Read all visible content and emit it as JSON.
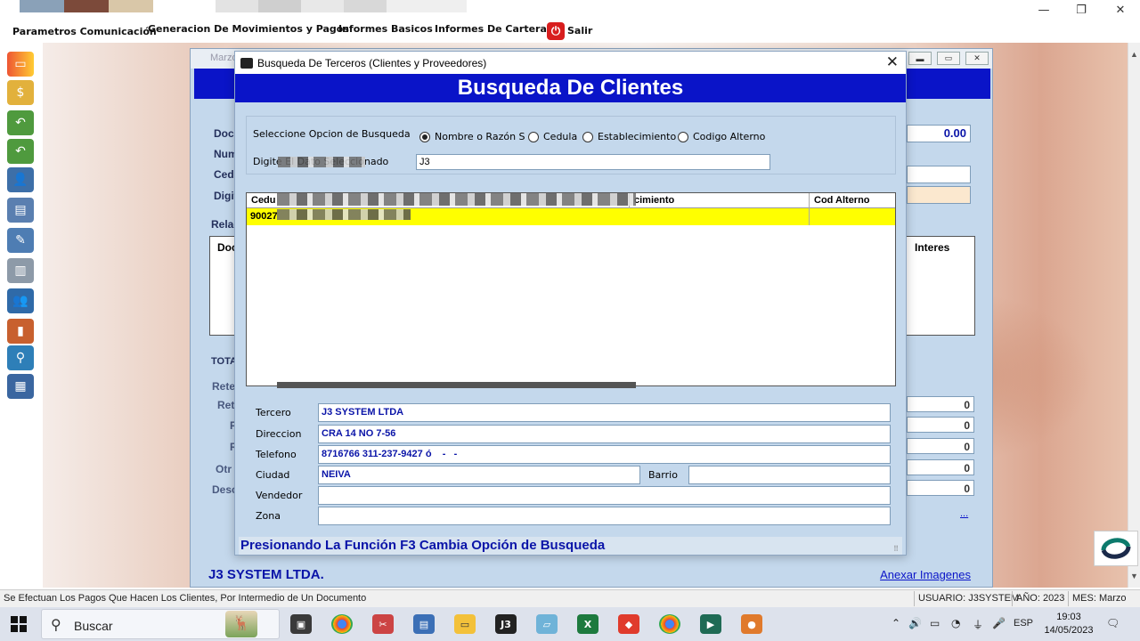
{
  "menu": {
    "items": [
      "Parametros Comunicación",
      "Generacion De Movimientos y Pagos",
      "Informes Basicos",
      "Informes De Cartera"
    ],
    "exit_label": "Salir"
  },
  "window_controls": {
    "minimize": "—",
    "restore": "❐",
    "close": "✕"
  },
  "back_window": {
    "title_fragment": "Marzo",
    "labels": [
      "Doc",
      "Num",
      "Cedu",
      "Digit",
      "Relac",
      "Doc",
      "TOTA",
      "Rete",
      "Ret",
      "F",
      "R",
      "Otr",
      "Desc"
    ],
    "interes_header": "Interes",
    "value_field": "0.00",
    "zero_values": [
      "0",
      "0",
      "0",
      "0",
      "0"
    ],
    "dots_link": "...",
    "footer_company": "J3 SYSTEM LTDA.",
    "annex_link": "Anexar Imagenes"
  },
  "dialog": {
    "title": "Busqueda De Terceros (Clientes y Proveedores)",
    "close_glyph": "✕",
    "banner": "Busqueda De Clientes",
    "option_label": "Seleccione Opcion de Busqueda",
    "options": [
      {
        "label": "Nombre o Razón S",
        "selected": true
      },
      {
        "label": "Cedula",
        "selected": false
      },
      {
        "label": "Establecimiento",
        "selected": false
      },
      {
        "label": "Codigo Alterno",
        "selected": false
      }
    ],
    "input_label": "Digite El Dato Seleccionado",
    "input_value": "J3",
    "grid": {
      "headers": [
        "Cedu",
        "cimiento",
        "Cod Alterno"
      ],
      "row": {
        "cedula": "90027",
        "cod_alterno": ""
      }
    },
    "info": {
      "tercero_label": "Tercero",
      "tercero_value": "J3 SYSTEM LTDA",
      "direccion_label": "Direccion",
      "direccion_value": "CRA 14 NO 7-56",
      "telefono_label": "Telefono",
      "telefono_value": "8716766 311-237-9427 ó    -   -",
      "ciudad_label": "Ciudad",
      "ciudad_value": "NEIVA",
      "barrio_label": "Barrio",
      "barrio_value": "",
      "vendedor_label": "Vendedor",
      "vendedor_value": "",
      "zona_label": "Zona",
      "zona_value": ""
    },
    "hint": "Presionando La Función F3 Cambia Opción de Busqueda"
  },
  "status_bar": {
    "message": "Se Efectuan Los Pagos Que Hacen  Los Clientes, Por Intermedio de Un Documento",
    "usuario": "USUARIO: J3SYSTEM",
    "anio": "AÑO: 2023",
    "mes": "MES: Marzo"
  },
  "taskbar": {
    "search_label": "Buscar",
    "language": "ESP",
    "time": "19:03",
    "date": "14/05/2023"
  },
  "colors": {
    "banner_blue": "#0a14c8",
    "panel_blue": "#c4d8ec",
    "selected_row": "#ffff00",
    "value_text": "#0a14a8"
  }
}
